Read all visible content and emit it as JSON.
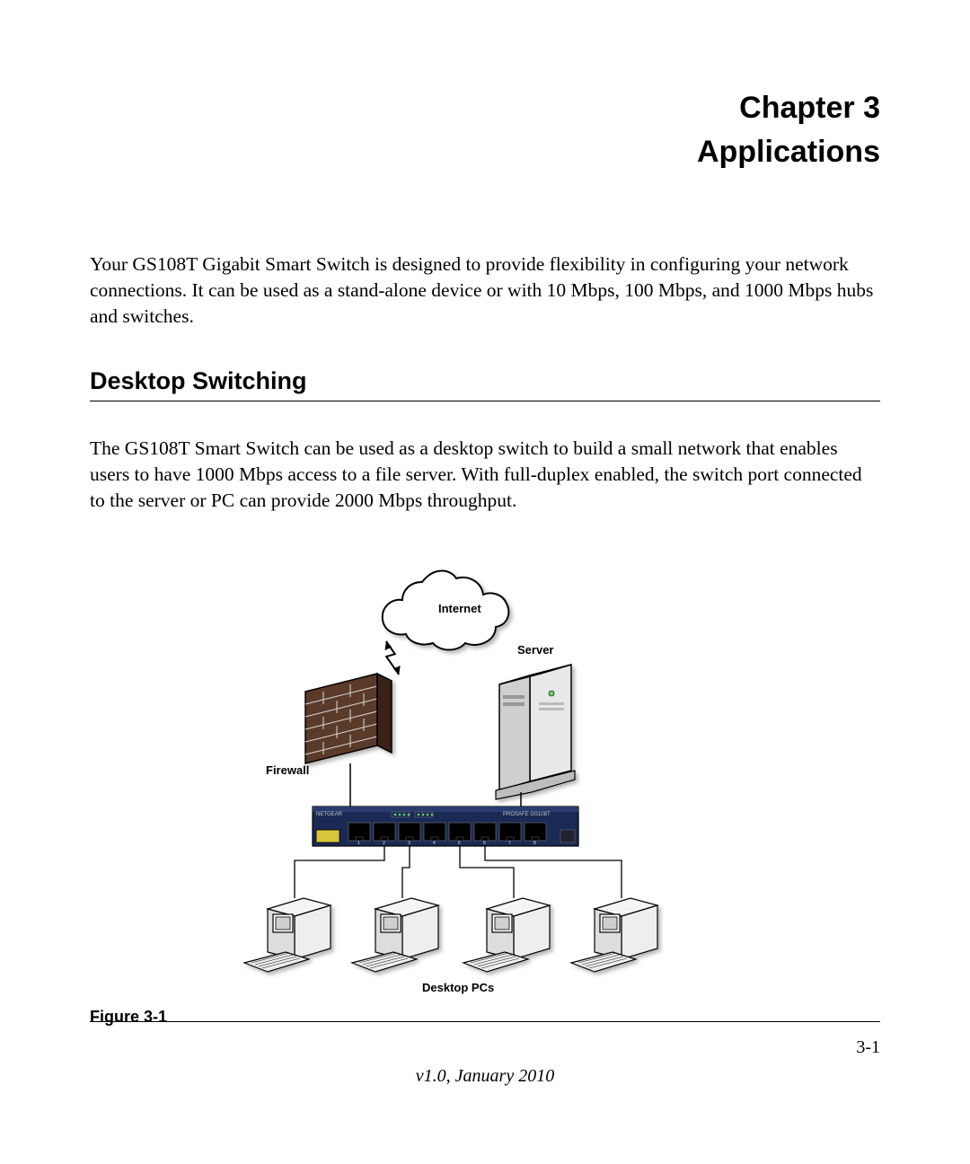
{
  "header": {
    "chapter_line": "Chapter 3",
    "chapter_title": "Applications"
  },
  "intro_paragraph": "Your GS108T Gigabit Smart Switch is designed to provide flexibility in configuring your network connections. It can be used as a stand-alone device or with 10 Mbps, 100 Mbps, and 1000 Mbps hubs and switches.",
  "section": {
    "heading": "Desktop Switching",
    "body": "The GS108T Smart Switch can be used as a desktop switch to build a small network that enables users to have 1000 Mbps access to a file server. With full-duplex enabled, the switch port connected to the server or PC can provide 2000 Mbps throughput."
  },
  "figure": {
    "caption": "Figure 3-1",
    "labels": {
      "internet": "Internet",
      "server": "Server",
      "firewall": "Firewall",
      "desktop_pcs": "Desktop PCs",
      "switch_brand": "NETGEAR",
      "switch_model": "PROSAFE GS108T",
      "port_numbers": [
        "1",
        "2",
        "3",
        "4",
        "5",
        "6",
        "7",
        "8"
      ]
    }
  },
  "footer": {
    "page_number": "3-1",
    "version": "v1.0, January 2010"
  }
}
